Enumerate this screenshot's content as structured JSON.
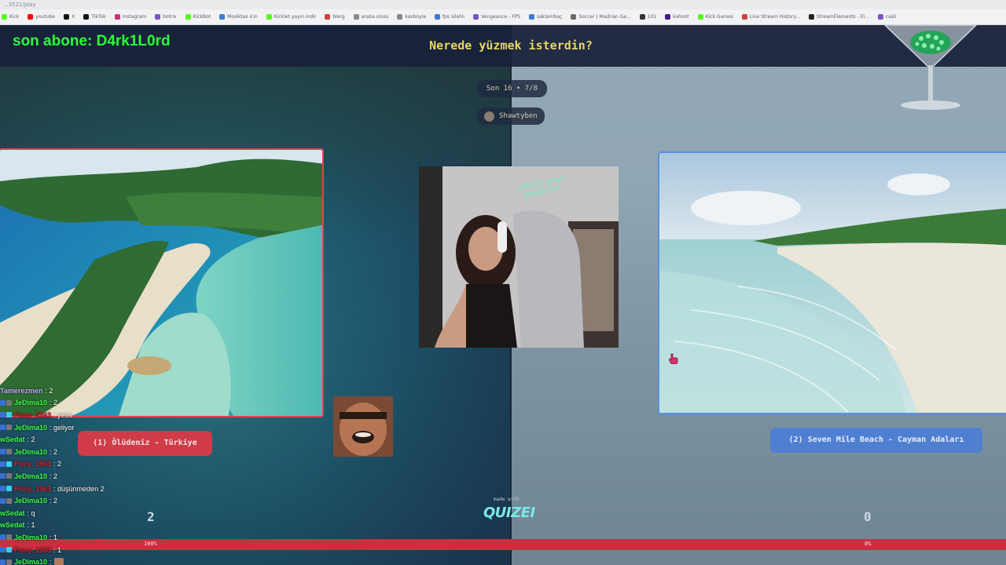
{
  "browser": {
    "url": "...3521/play",
    "bookmarks": [
      {
        "label": "Kick",
        "color": "#53fc18"
      },
      {
        "label": "youtube",
        "color": "#ff0000"
      },
      {
        "label": "X",
        "color": "#111111"
      },
      {
        "label": "TikTok",
        "color": "#111111"
      },
      {
        "label": "Instagram",
        "color": "#d62976"
      },
      {
        "label": "botrix",
        "color": "#7a55c4"
      },
      {
        "label": "KickBot",
        "color": "#53fc18"
      },
      {
        "label": "Mosiktas icin",
        "color": "#3e7bd6"
      },
      {
        "label": "Kicklet yayın indir",
        "color": "#53fc18"
      },
      {
        "label": "blerg",
        "color": "#d43f3f"
      },
      {
        "label": "araba oluss",
        "color": "#888888"
      },
      {
        "label": "kashoyla",
        "color": "#888888"
      },
      {
        "label": "fps silahlı",
        "color": "#3e7bd6"
      },
      {
        "label": "Vengeance - FPS",
        "color": "#7a55c4"
      },
      {
        "label": "saklambaç",
        "color": "#3e7bd6"
      },
      {
        "label": "Soccer | Madrian Ga...",
        "color": "#6a6a6a"
      },
      {
        "label": "101",
        "color": "#333333"
      },
      {
        "label": "kahoot",
        "color": "#46178f"
      },
      {
        "label": "Kick Games",
        "color": "#53fc18"
      },
      {
        "label": "Live Stream History...",
        "color": "#d43f3f"
      },
      {
        "label": "StreamElements - El...",
        "color": "#222222"
      },
      {
        "label": "casli",
        "color": "#7a55c4"
      }
    ]
  },
  "overlay": {
    "subscriber_text": "son abone: D4rk1L0rd"
  },
  "quiz": {
    "question": "Nerede yüzmek isterdin?",
    "round": "Son 16 • 7/8",
    "player": "Shawtyben",
    "options": [
      {
        "label": "(1) Ölüdeniz - Türkiye",
        "votes": "2",
        "percent": "100%"
      },
      {
        "label": "(2) Seven Mile Beach - Cayman Adaları",
        "votes": "0",
        "percent": "0%"
      }
    ],
    "made_with": "made with",
    "brand": "QUIZEI"
  },
  "webcam": {
    "sticker_text": "what's your problem?"
  },
  "chat": [
    {
      "user": "Tamerezmen",
      "msg": ": 2",
      "color": "#c9a8ff",
      "badges": []
    },
    {
      "user": "JeDima10",
      "msg": ": 2",
      "color": "#3cff4a",
      "badges": [
        "#3a6fd8",
        "#777777"
      ]
    },
    {
      "user": "Pony_1963",
      "msg": ": yess",
      "color": "#d0242f",
      "badges": [
        "#3a6fd8",
        "#3acff0"
      ]
    },
    {
      "user": "JeDima10",
      "msg": ": geliyor",
      "color": "#3cff4a",
      "badges": [
        "#3a6fd8",
        "#777777"
      ]
    },
    {
      "user": "wSedat",
      "msg": ": 2",
      "color": "#3cff4a",
      "badges": []
    },
    {
      "user": "JeDima10",
      "msg": ": 2",
      "color": "#3cff4a",
      "badges": [
        "#3a6fd8",
        "#777777"
      ]
    },
    {
      "user": "Pony_1963",
      "msg": ": 2",
      "color": "#d0242f",
      "badges": [
        "#3a6fd8",
        "#3acff0"
      ]
    },
    {
      "user": "JeDima10",
      "msg": ": 2",
      "color": "#3cff4a",
      "badges": [
        "#3a6fd8",
        "#777777"
      ]
    },
    {
      "user": "Pony_1963",
      "msg": ": düşünmeden 2",
      "color": "#d0242f",
      "badges": [
        "#3a6fd8",
        "#3acff0"
      ]
    },
    {
      "user": "JeDima10",
      "msg": ": 2",
      "color": "#3cff4a",
      "badges": [
        "#3a6fd8",
        "#777777"
      ]
    },
    {
      "user": "wSedat",
      "msg": ": q",
      "color": "#3cff4a",
      "badges": []
    },
    {
      "user": "wSedat",
      "msg": ": 1",
      "color": "#3cff4a",
      "badges": []
    },
    {
      "user": "JeDima10",
      "msg": ": 1",
      "color": "#3cff4a",
      "badges": [
        "#3a6fd8",
        "#777777"
      ]
    },
    {
      "user": "Pony_1963",
      "msg": ": 1",
      "color": "#d0242f",
      "badges": [
        "#3a6fd8",
        "#3acff0"
      ]
    },
    {
      "user": "JeDima10",
      "msg": ":",
      "color": "#3cff4a",
      "badges": [
        "#3a6fd8",
        "#777777"
      ],
      "emote": true
    }
  ],
  "colors": {
    "left_accent": "#cf3b47",
    "right_accent": "#4f7fd1",
    "question": "#e6d56a",
    "subscriber": "#2bff3a",
    "brand": "#7de7e9"
  }
}
